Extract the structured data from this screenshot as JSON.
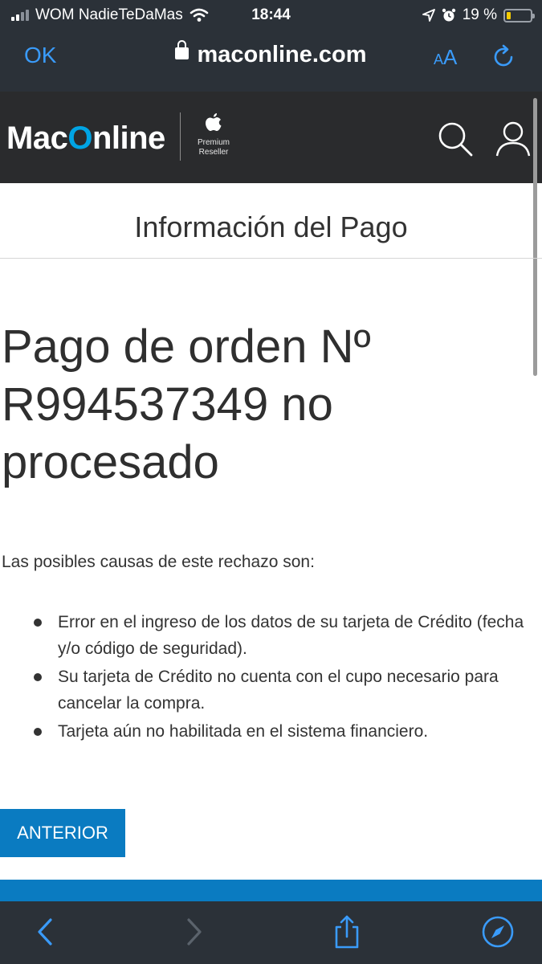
{
  "status_bar": {
    "carrier": "WOM NadieTeDaMas",
    "time": "18:44",
    "battery": "19 %",
    "battery_level": 0.19
  },
  "browser": {
    "done_label": "OK",
    "url": "maconline.com",
    "text_size_label": "AA"
  },
  "header": {
    "logo_prefix": "Mac",
    "logo_o": "O",
    "logo_suffix": "nline",
    "reseller_line1": "Premium",
    "reseller_line2": "Reseller"
  },
  "page": {
    "title": "Información del Pago",
    "headline": "Pago de orden Nº R994537349 no procesado",
    "intro": "Las posibles causas de este rechazo son:",
    "causes": [
      "Error en el ingreso de los datos de su tarjeta de Crédito (fecha y/o código de seguridad).",
      "Su tarjeta de Crédito no cuenta con el cupo necesario para cancelar la compra.",
      "Tarjeta aún no habilitada en el sistema financiero."
    ],
    "back_button": "ANTERIOR"
  },
  "colors": {
    "accent_blue": "#0a7bc1",
    "ios_blue": "#3a9bfa",
    "header_dark": "#2a2b2d",
    "logo_blue": "#00a4e4"
  },
  "icons": [
    "wifi-icon",
    "location-icon",
    "alarm-icon",
    "lock-icon",
    "reload-icon",
    "search-icon",
    "user-icon",
    "back-icon",
    "forward-icon",
    "share-icon",
    "compass-icon"
  ]
}
